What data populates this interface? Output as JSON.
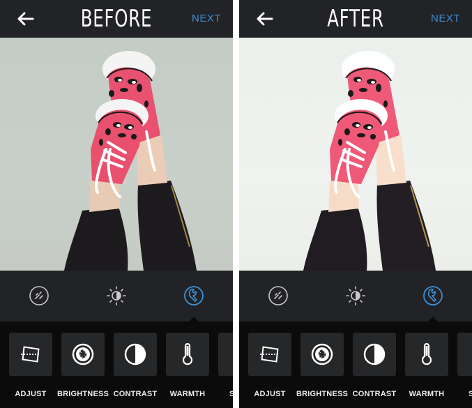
{
  "panels": [
    {
      "id": "before",
      "header": {
        "back_icon": "arrow-left-icon",
        "title": "BEFORE",
        "next_label": "NEXT"
      },
      "photo": {
        "description": "Legs in black leggings with pink leopard-print sneakers against a wall",
        "tone": "original"
      },
      "toolbar": {
        "tools": [
          {
            "name": "lux",
            "icon": "lux-wand-icon",
            "active": false
          },
          {
            "name": "brightness-contrast",
            "icon": "sun-half-icon",
            "active": false
          },
          {
            "name": "tools",
            "icon": "wrench-icon",
            "active": true
          }
        ]
      },
      "tiles": [
        {
          "label": "ADJUST",
          "icon": "adjust-rotate-icon"
        },
        {
          "label": "BRIGHTNESS",
          "icon": "aperture-icon"
        },
        {
          "label": "CONTRAST",
          "icon": "contrast-icon"
        },
        {
          "label": "WARMTH",
          "icon": "thermometer-icon"
        },
        {
          "label": "SATU",
          "icon": "saturation-icon"
        }
      ]
    },
    {
      "id": "after",
      "header": {
        "back_icon": "arrow-left-icon",
        "title": "AFTER",
        "next_label": "NEXT"
      },
      "photo": {
        "description": "Same photo brightened and whitened",
        "tone": "brightened"
      },
      "toolbar": {
        "tools": [
          {
            "name": "lux",
            "icon": "lux-wand-icon",
            "active": false
          },
          {
            "name": "brightness-contrast",
            "icon": "sun-half-icon",
            "active": false
          },
          {
            "name": "tools",
            "icon": "wrench-icon",
            "active": true
          }
        ]
      },
      "tiles": [
        {
          "label": "ADJUST",
          "icon": "adjust-rotate-icon"
        },
        {
          "label": "BRIGHTNESS",
          "icon": "aperture-icon"
        },
        {
          "label": "CONTRAST",
          "icon": "contrast-icon"
        },
        {
          "label": "WARMTH",
          "icon": "thermometer-icon"
        },
        {
          "label": "SATU",
          "icon": "saturation-icon"
        }
      ]
    }
  ],
  "colors": {
    "accent": "#3d8fd8",
    "header_bg": "#222326",
    "toolbar_bg": "#222326",
    "tray_bg": "#0b0b0c",
    "tile_bg": "#262729",
    "icon_inactive": "#c8c8c8"
  }
}
